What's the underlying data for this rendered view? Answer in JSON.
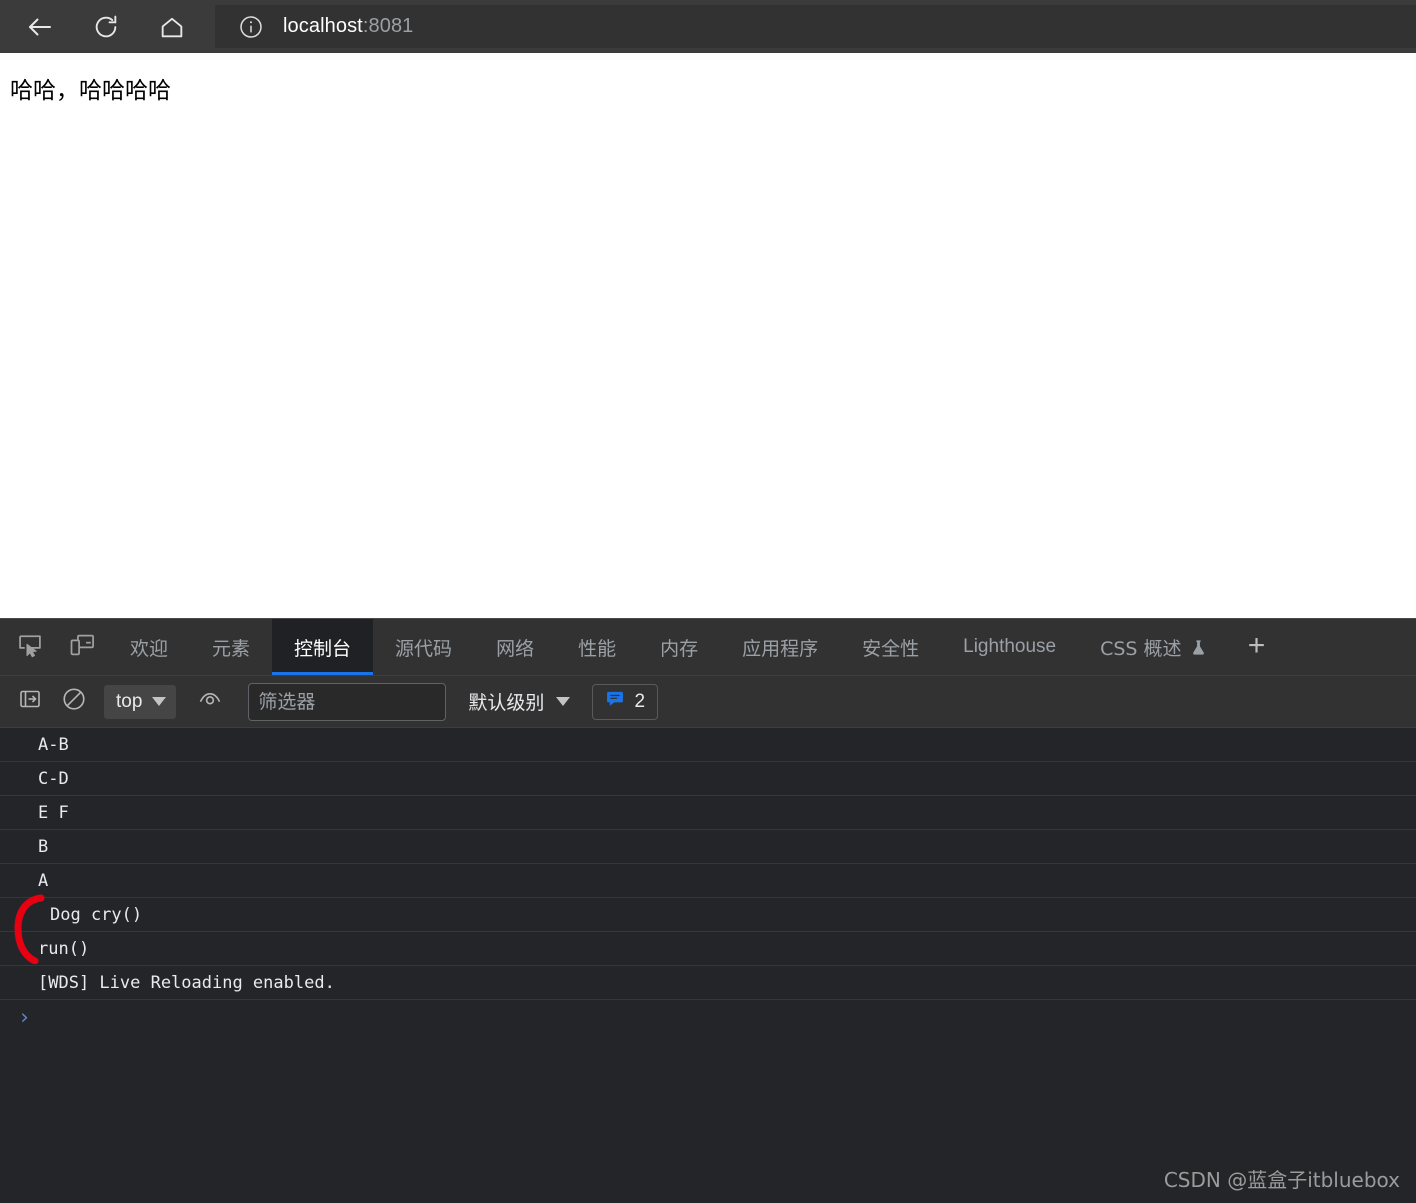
{
  "browser": {
    "back_label": "back-arrow",
    "reload_label": "reload",
    "home_label": "home",
    "url_host": "localhost",
    "url_port": ":8081",
    "info_icon": "info-icon"
  },
  "page": {
    "text": "哈哈，哈哈哈哈"
  },
  "devtools": {
    "inspect_icon": "inspect-element-icon",
    "device_icon": "device-toolbar-icon",
    "tabs": [
      {
        "label": "欢迎",
        "active": false
      },
      {
        "label": "元素",
        "active": false
      },
      {
        "label": "控制台",
        "active": true
      },
      {
        "label": "源代码",
        "active": false
      },
      {
        "label": "网络",
        "active": false
      },
      {
        "label": "性能",
        "active": false
      },
      {
        "label": "内存",
        "active": false
      },
      {
        "label": "应用程序",
        "active": false
      },
      {
        "label": "安全性",
        "active": false
      },
      {
        "label": "Lighthouse",
        "active": false
      },
      {
        "label": "CSS 概述",
        "active": false,
        "experiment": true
      }
    ],
    "add_tab_label": "+",
    "toolbar": {
      "sidebar_icon": "show-console-sidebar-icon",
      "clear_icon": "clear-console-icon",
      "context": "top",
      "eye_icon": "live-expression-icon",
      "filter_placeholder": "筛选器",
      "filter_value": "",
      "level": "默认级别",
      "issues_icon": "issues-speech-bubble-icon",
      "issues_count": "2"
    },
    "console_rows": [
      {
        "text": "A-B",
        "indent": false
      },
      {
        "text": "C-D",
        "indent": false
      },
      {
        "text": "E F",
        "indent": false
      },
      {
        "text": "B",
        "indent": false
      },
      {
        "text": "A",
        "indent": false
      },
      {
        "text": "Dog cry()",
        "indent": true
      },
      {
        "text": "run()",
        "indent": false
      },
      {
        "text": "[WDS] Live Reloading enabled.",
        "indent": false
      }
    ],
    "prompt_symbol": "›",
    "annotation_color": "#e60012"
  },
  "watermark": "CSDN @蓝盒子itbluebox"
}
